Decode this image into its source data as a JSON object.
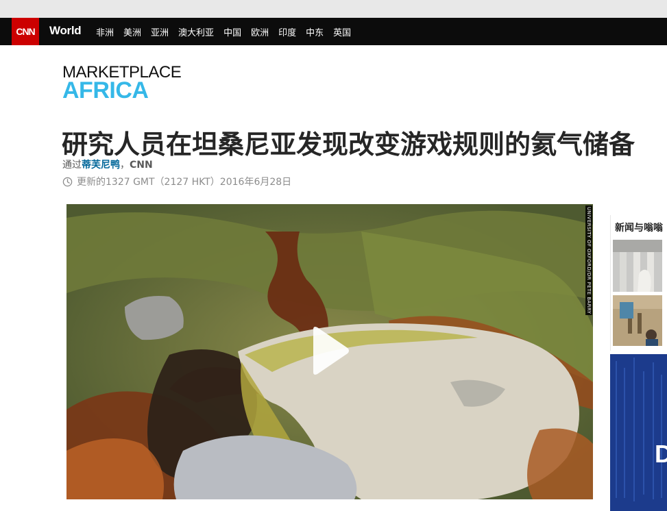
{
  "nav": {
    "logo": "CNN",
    "section": "World",
    "items": [
      "非洲",
      "美洲",
      "亚洲",
      "澳大利亚",
      "中国",
      "欧洲",
      "印度",
      "中东",
      "英国"
    ]
  },
  "brand": {
    "line1": "MARKETPLACE",
    "line2": "AFRICA"
  },
  "article": {
    "headline": "研究人员在坦桑尼亚发现改变游戏规则的氦气储备",
    "byline_prefix": "通过",
    "author": "蒂芙尼鸭",
    "byline_sep": "，",
    "source": "CNN",
    "timestamp": "更新的1327 GMT（2127 HKT）2016年6月28日"
  },
  "video": {
    "credit": "UNIVERSITY OF OXFORD/DR PETE BARRY",
    "play_icon": "play-icon"
  },
  "sidebar": {
    "title": "新闻与嗡嗡"
  },
  "ad": {
    "letter": "D"
  },
  "colors": {
    "nav_bg": "#0c0c0c",
    "cnn_red": "#cc0000",
    "africa_blue": "#35b8e8",
    "author_link": "#006699"
  }
}
